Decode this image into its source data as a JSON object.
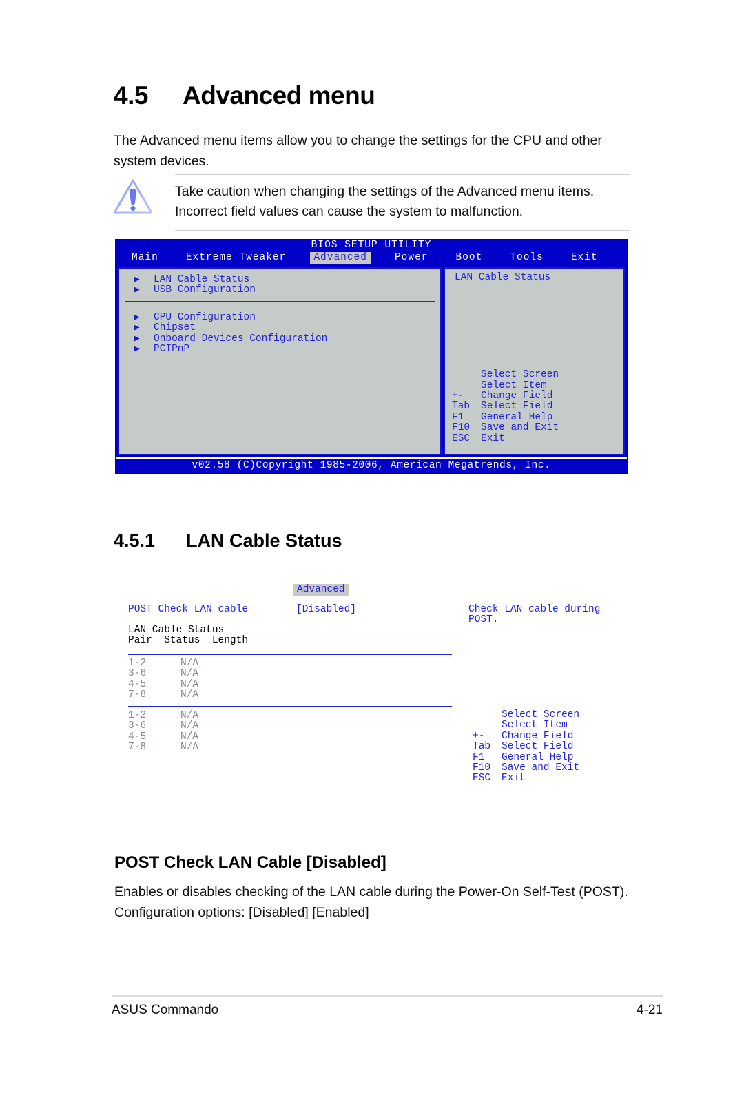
{
  "section": {
    "number": "4.5",
    "title": "Advanced menu",
    "intro": "The Advanced menu items allow you to change the settings for the CPU and other system devices."
  },
  "caution": {
    "icon": "warning-triangle-icon",
    "text": "Take caution when changing the settings of the Advanced menu items. Incorrect field values can cause the system to malfunction."
  },
  "bios_screen_1": {
    "title": "BIOS SETUP UTILITY",
    "tabs": [
      {
        "label": "Main",
        "active": false
      },
      {
        "label": "Extreme Tweaker",
        "active": false
      },
      {
        "label": "Advanced",
        "active": true
      },
      {
        "label": "Power",
        "active": false
      },
      {
        "label": "Boot",
        "active": false
      },
      {
        "label": "Tools",
        "active": false
      },
      {
        "label": "Exit",
        "active": false
      }
    ],
    "menu_group_1": [
      "LAN Cable Status",
      "USB Configuration"
    ],
    "menu_group_2": [
      "CPU Configuration",
      "Chipset",
      "Onboard Devices Configuration",
      "PCIPnP"
    ],
    "help_title": "LAN Cable Status",
    "keys": [
      {
        "key": "",
        "desc": "Select Screen"
      },
      {
        "key": "",
        "desc": "Select Item"
      },
      {
        "key": "+-",
        "desc": "Change Field"
      },
      {
        "key": "Tab",
        "desc": "Select Field"
      },
      {
        "key": "F1",
        "desc": "General Help"
      },
      {
        "key": "F10",
        "desc": "Save and Exit"
      },
      {
        "key": "ESC",
        "desc": "Exit"
      }
    ],
    "footer": "v02.58 (C)Copyright 1985-2006, American Megatrends, Inc."
  },
  "subsection": {
    "number": "4.5.1",
    "title": "LAN Cable Status"
  },
  "bios_screen_2": {
    "tab_label": "Advanced",
    "post_check_label": "POST Check LAN cable",
    "post_check_value": "[Disabled]",
    "post_help": "Check LAN cable during POST.",
    "status_heading_line1": "LAN Cable Status",
    "status_heading_line2": "Pair  Status  Length",
    "table_a": [
      {
        "pair": "1-2",
        "status": "N/A",
        "length": ""
      },
      {
        "pair": "3-6",
        "status": "N/A",
        "length": ""
      },
      {
        "pair": "4-5",
        "status": "N/A",
        "length": ""
      },
      {
        "pair": "7-8",
        "status": "N/A",
        "length": ""
      }
    ],
    "table_b": [
      {
        "pair": "1-2",
        "status": "N/A",
        "length": ""
      },
      {
        "pair": "3-6",
        "status": "N/A",
        "length": ""
      },
      {
        "pair": "4-5",
        "status": "N/A",
        "length": ""
      },
      {
        "pair": "7-8",
        "status": "N/A",
        "length": ""
      }
    ],
    "keys": [
      {
        "key": "",
        "desc": "Select Screen"
      },
      {
        "key": "",
        "desc": "Select Item"
      },
      {
        "key": "+-",
        "desc": "Change Field"
      },
      {
        "key": "Tab",
        "desc": "Select Field"
      },
      {
        "key": "F1",
        "desc": "General Help"
      },
      {
        "key": "F10",
        "desc": "Save and Exit"
      },
      {
        "key": "ESC",
        "desc": "Exit"
      }
    ]
  },
  "item": {
    "heading": "POST Check LAN Cable  [Disabled]",
    "description": "Enables or disables checking of the LAN cable during the Power-On Self-Test (POST). Configuration options: [Disabled] [Enabled]"
  },
  "footer": {
    "product": "ASUS Commando",
    "page": "4-21"
  },
  "colors": {
    "bios_blue_bg": "#0000c8",
    "bios_panel_bg": "#c5cbc8",
    "bios_text_blue": "#2222dd",
    "bios_disabled_gray": "#808b84",
    "accent_tab_bg": "#c8c8c8"
  }
}
